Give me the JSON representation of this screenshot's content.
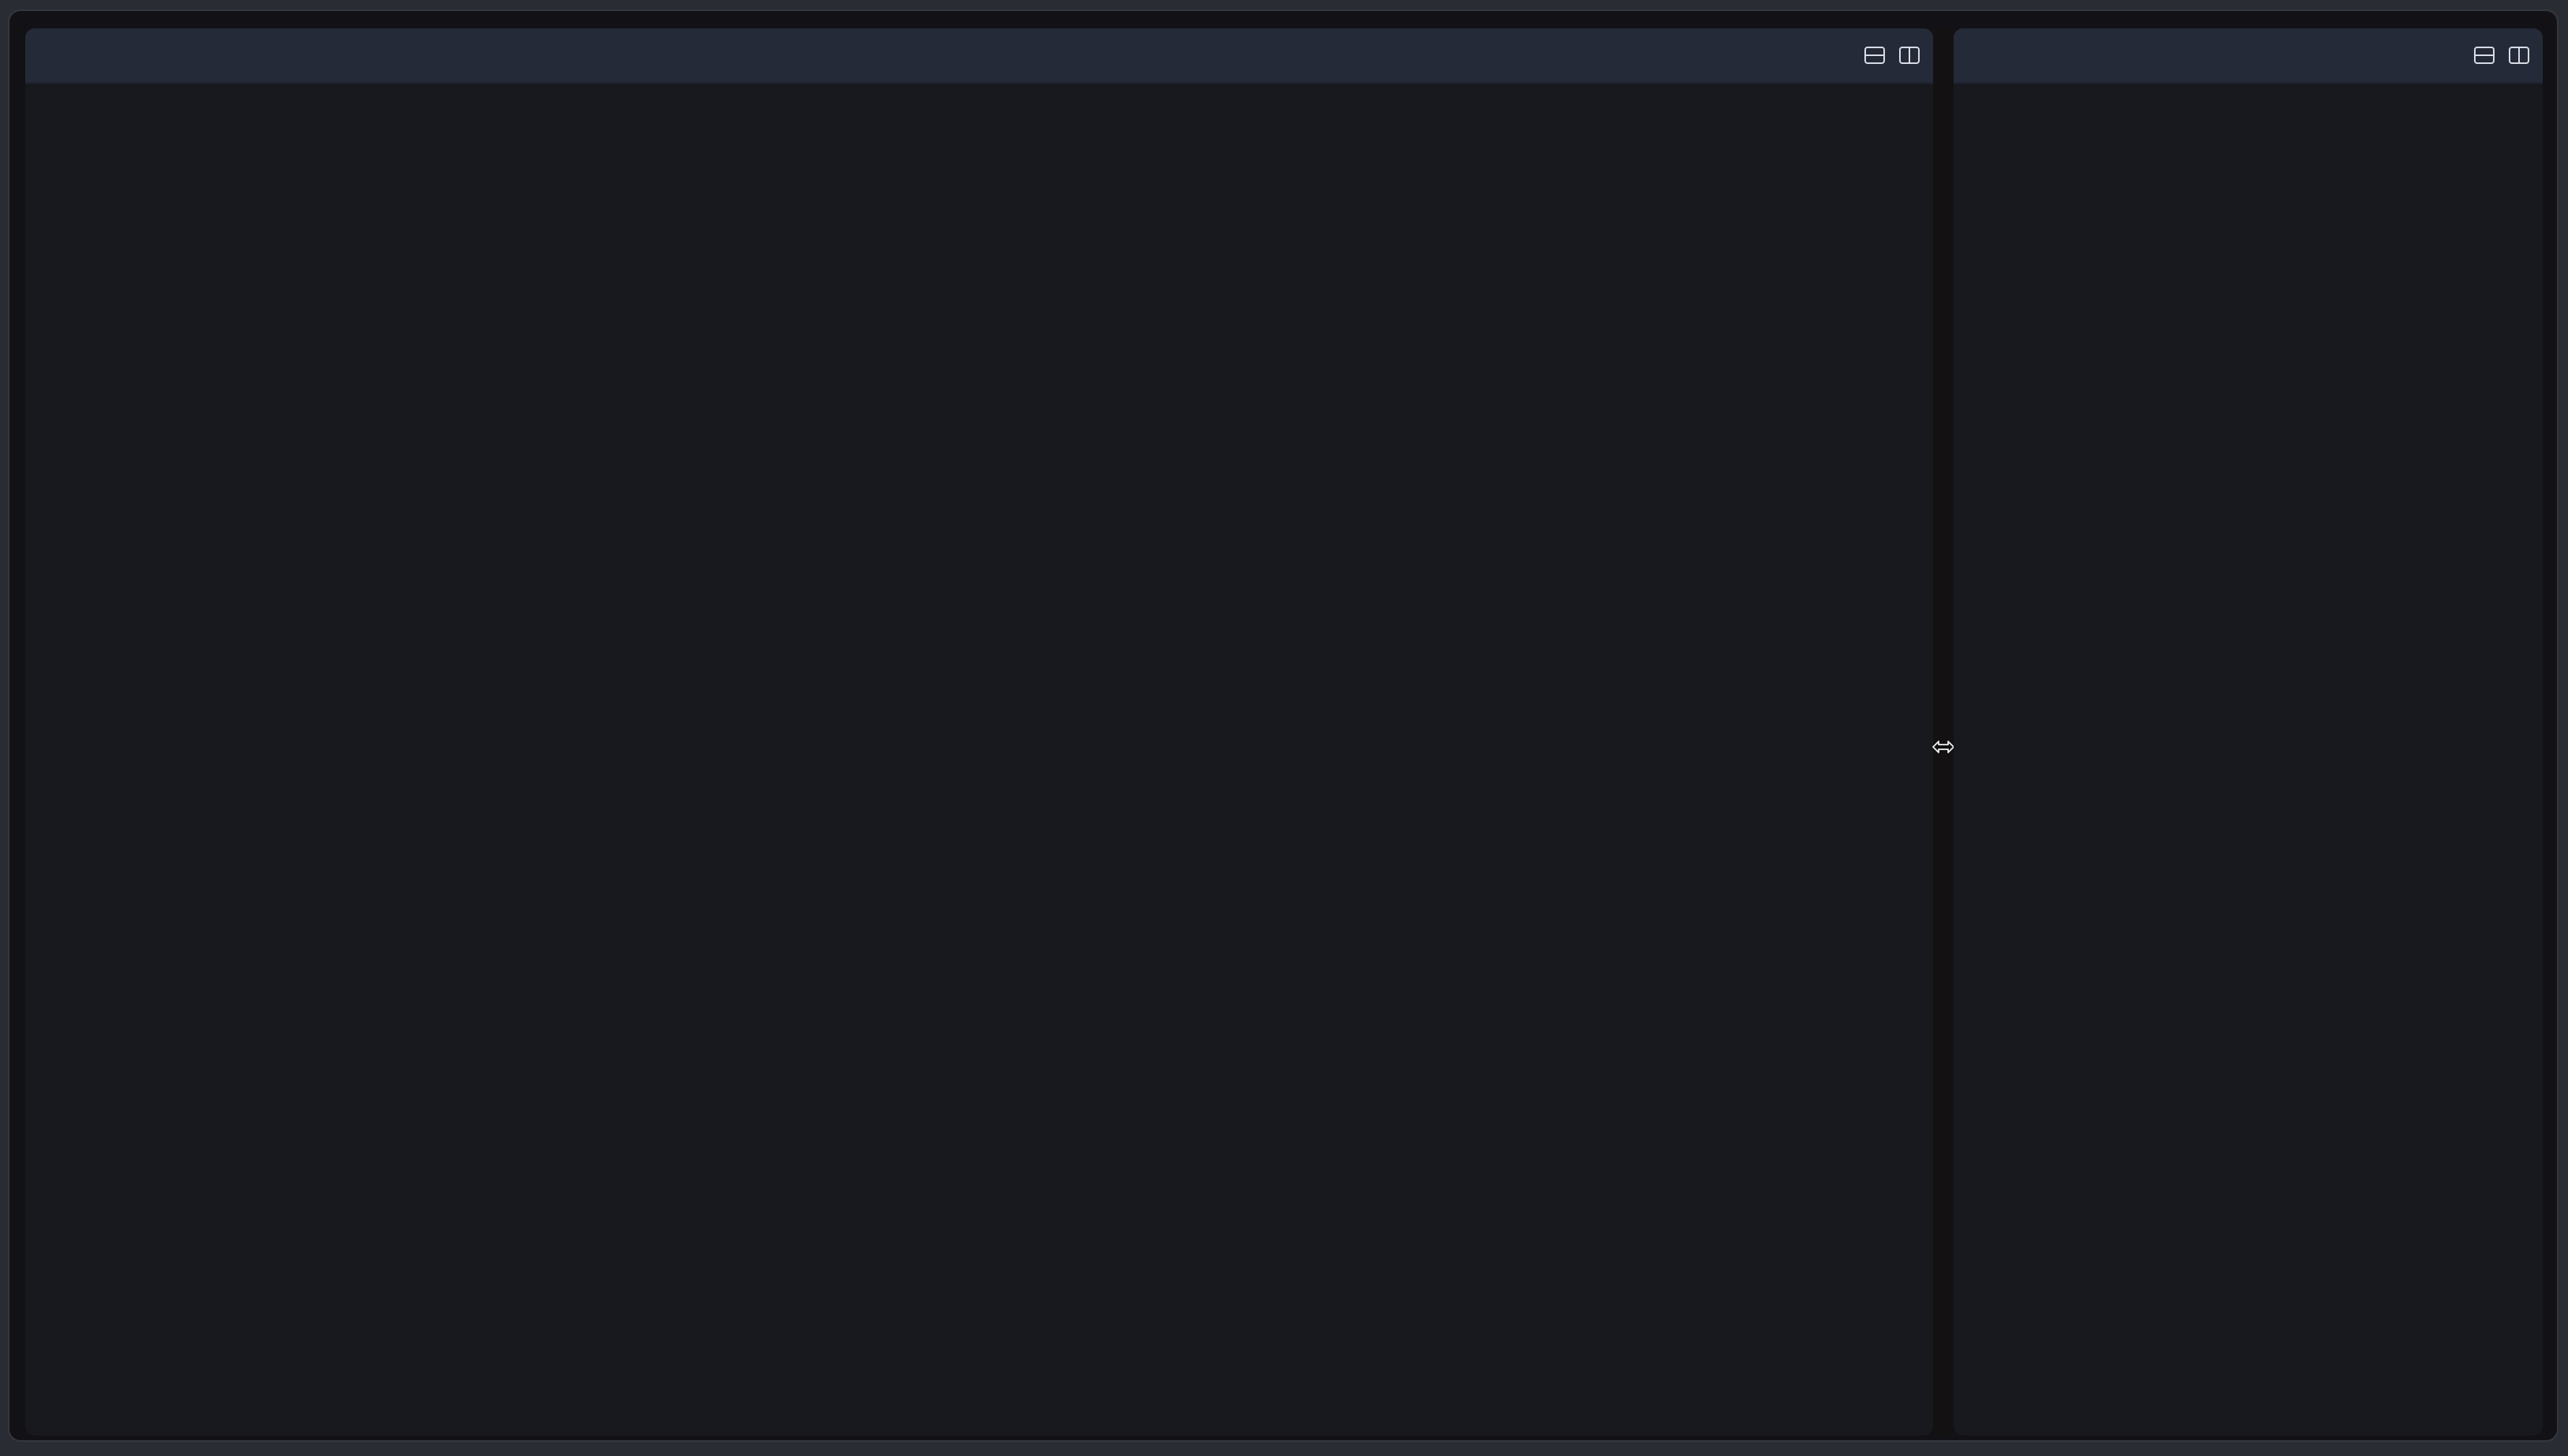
{
  "window": {
    "panes": [
      {
        "id": "left",
        "actions": [
          {
            "icon": "split-horizontal-icon"
          },
          {
            "icon": "split-vertical-icon"
          }
        ]
      },
      {
        "id": "right",
        "actions": [
          {
            "icon": "split-horizontal-icon"
          },
          {
            "icon": "split-vertical-icon"
          }
        ]
      }
    ],
    "divider": {
      "cursor_icon": "resize-horizontal-cursor-icon"
    }
  },
  "colors": {
    "page_background": "#2a2c33",
    "window_background": "#121216",
    "pane_background": "#18191e",
    "header_background": "#252a38",
    "divider_background": "#141112",
    "icon_color": "#d8dbe5"
  }
}
